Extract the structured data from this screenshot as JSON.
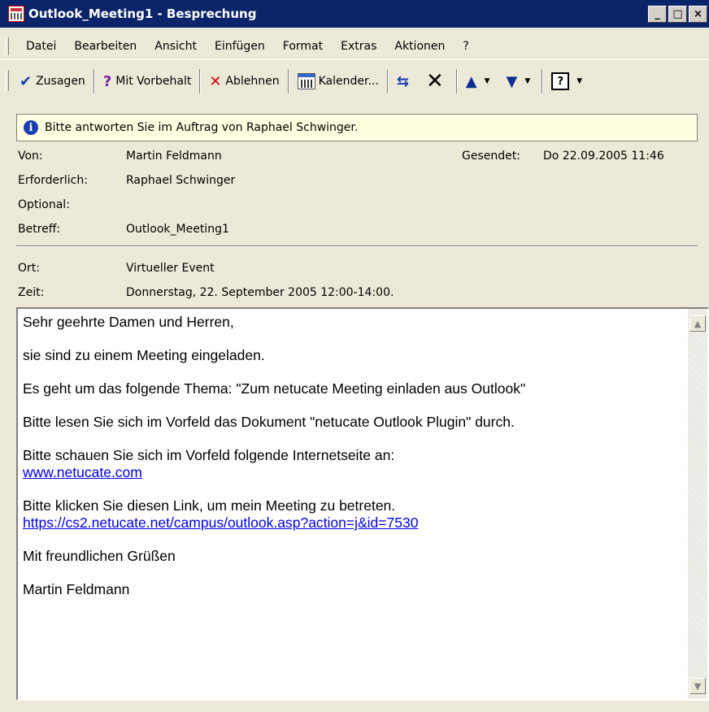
{
  "window": {
    "title": "Outlook_Meeting1 - Besprechung",
    "buttons": {
      "minimize": "_",
      "maximize": "□",
      "close": "×"
    }
  },
  "menu": [
    "Datei",
    "Bearbeiten",
    "Ansicht",
    "Einfügen",
    "Format",
    "Extras",
    "Aktionen",
    "?"
  ],
  "toolbar": {
    "accept": "Zusagen",
    "tentative": "Mit Vorbehalt",
    "decline": "Ablehnen",
    "calendar": "Kalender..."
  },
  "infobar": {
    "text": "Bitte antworten Sie im Auftrag von Raphael Schwinger."
  },
  "header": {
    "from_label": "Von:",
    "from_value": "Martin Feldmann",
    "sent_label": "Gesendet:",
    "sent_value": "Do 22.09.2005 11:46",
    "required_label": "Erforderlich:",
    "required_value": "Raphael Schwinger",
    "optional_label": "Optional:",
    "optional_value": "",
    "subject_label": "Betreff:",
    "subject_value": "Outlook_Meeting1",
    "location_label": "Ort:",
    "location_value": "Virtueller Event",
    "time_label": "Zeit:",
    "time_value": "Donnerstag, 22. September 2005 12:00-14:00."
  },
  "body": {
    "greeting": "Sehr geehrte Damen und Herren,",
    "invite": "sie sind zu einem Meeting eingeladen.",
    "topic": "Es geht um das folgende Thema: \"Zum netucate Meeting einladen aus Outlook\"",
    "document": "Bitte lesen Sie sich im Vorfeld das Dokument \"netucate Outlook Plugin\" durch.",
    "website_intro": "Bitte schauen Sie sich im Vorfeld folgende Internetseite an:",
    "website_link": "www.netucate.com",
    "meeting_intro": "Bitte klicken Sie diesen Link, um mein Meeting zu betreten.",
    "meeting_link": "https://cs2.netucate.net/campus/outlook.asp?action=j&id=7530",
    "closing": "Mit freundlichen Grüßen",
    "signature": "Martin Feldmann"
  }
}
